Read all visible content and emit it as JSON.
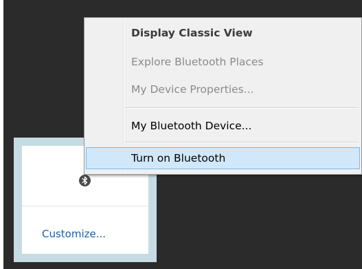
{
  "context_menu": {
    "items": [
      {
        "label": "Display Classic View",
        "state": "default"
      },
      {
        "label": "Explore Bluetooth Places",
        "state": "disabled"
      },
      {
        "label": "My Device Properties...",
        "state": "disabled"
      },
      {
        "label": "My Bluetooth Device...",
        "state": "enabled"
      },
      {
        "label": "Turn on Bluetooth",
        "state": "highlighted"
      }
    ]
  },
  "tray_flyout": {
    "icons": [
      {
        "name": "bluetooth-icon"
      }
    ],
    "customize_label": "Customize..."
  },
  "colors": {
    "desktop": "#2b2b2b",
    "flyout_border": "#c7dbe4",
    "menu_background": "#f0f0f0",
    "highlight_fill": "#d1e8fa",
    "highlight_border": "#7ab9e8",
    "link": "#1a5e9e"
  }
}
